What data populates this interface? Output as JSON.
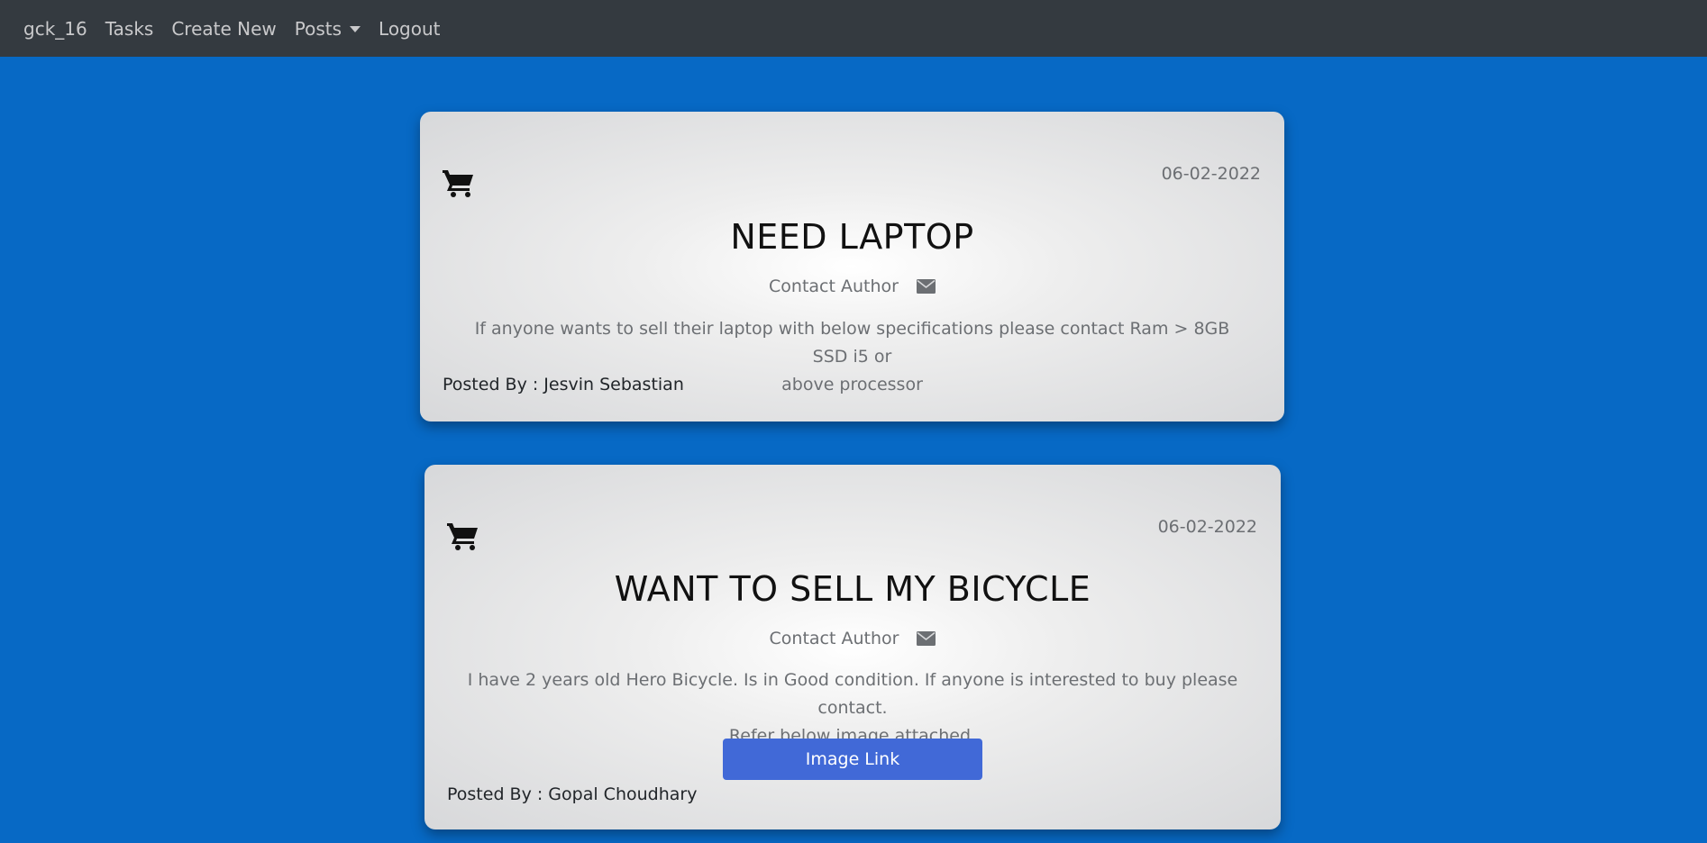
{
  "nav": {
    "brand": "gck_16",
    "tasks": "Tasks",
    "create_new": "Create New",
    "posts": "Posts",
    "logout": "Logout"
  },
  "colors": {
    "background": "#0769c5",
    "navbar": "#343a40",
    "button": "#4169d7"
  },
  "posts": [
    {
      "icon": "cart-icon",
      "date": "06-02-2022",
      "title": "NEED LAPTOP",
      "contact_label": "Contact Author",
      "contact_icon": "envelope-icon",
      "body_line1": "If anyone wants to sell their laptop with below specifications please contact Ram > 8GB SSD i5 or",
      "body_line2": "above processor",
      "posted_by": "Posted By : Jesvin Sebastian"
    },
    {
      "icon": "cart-icon",
      "date": "06-02-2022",
      "title": "WANT TO SELL MY BICYCLE",
      "contact_label": "Contact Author",
      "contact_icon": "envelope-icon",
      "body_line1": "I have 2 years old Hero Bicycle. Is in Good condition. If anyone is interested to buy please contact.",
      "body_line2": "Refer below image attached.",
      "image_button": "Image Link",
      "posted_by": "Posted By : Gopal Choudhary"
    }
  ]
}
